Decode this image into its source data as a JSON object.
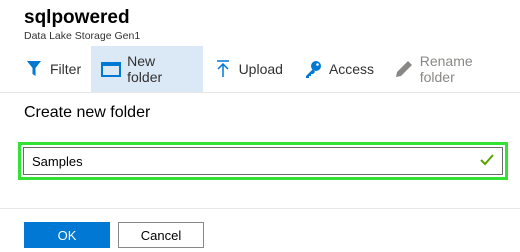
{
  "header": {
    "title": "sqlpowered",
    "subtitle": "Data Lake Storage Gen1"
  },
  "toolbar": {
    "filter_label": "Filter",
    "new_folder_label": "New folder",
    "upload_label": "Upload",
    "access_label": "Access",
    "rename_folder_label": "Rename folder"
  },
  "dialog": {
    "title": "Create new folder",
    "folder_name_value": "Samples",
    "ok_label": "OK",
    "cancel_label": "Cancel"
  },
  "colors": {
    "accent": "#0078d4",
    "focus_border": "#34e234",
    "valid_check": "#57a300",
    "active_tab_bg": "#dbe9f7"
  },
  "icons": {
    "filter": "funnel-icon",
    "new_folder": "folder-icon",
    "upload": "upload-arrow-icon",
    "access": "key-icon",
    "rename": "pencil-icon",
    "valid": "checkmark-icon"
  }
}
